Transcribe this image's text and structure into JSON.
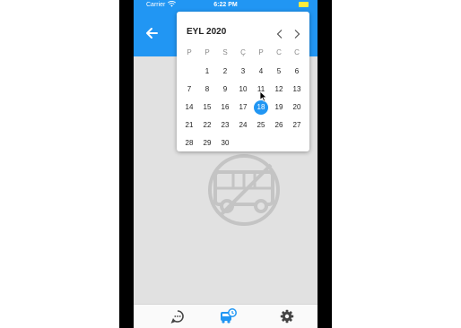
{
  "status_bar": {
    "carrier": "Carrier",
    "time": "6:22 PM"
  },
  "app_bar": {
    "back_icon": "arrow-back-icon"
  },
  "date_picker": {
    "month_label": "EYL 2020",
    "weekdays": [
      "P",
      "P",
      "S",
      "Ç",
      "P",
      "C",
      "C"
    ],
    "days": [
      "1",
      "2",
      "3",
      "4",
      "5",
      "6",
      "7",
      "8",
      "9",
      "10",
      "11",
      "12",
      "13",
      "14",
      "15",
      "16",
      "17",
      "18",
      "19",
      "20",
      "21",
      "22",
      "23",
      "24",
      "25",
      "26",
      "27",
      "28",
      "29",
      "30"
    ],
    "first_weekday_offset": 1,
    "selected_day": "18"
  },
  "empty_state": {
    "icon": "no-bus-icon"
  },
  "bottom_nav": {
    "items": [
      "chat-icon",
      "bus-schedule-icon",
      "settings-icon"
    ],
    "active": "bus-schedule-icon"
  },
  "colors": {
    "primary": "#2196f3",
    "screen_bg": "#e1e1e1",
    "selected_day_bg": "#2196f3"
  }
}
